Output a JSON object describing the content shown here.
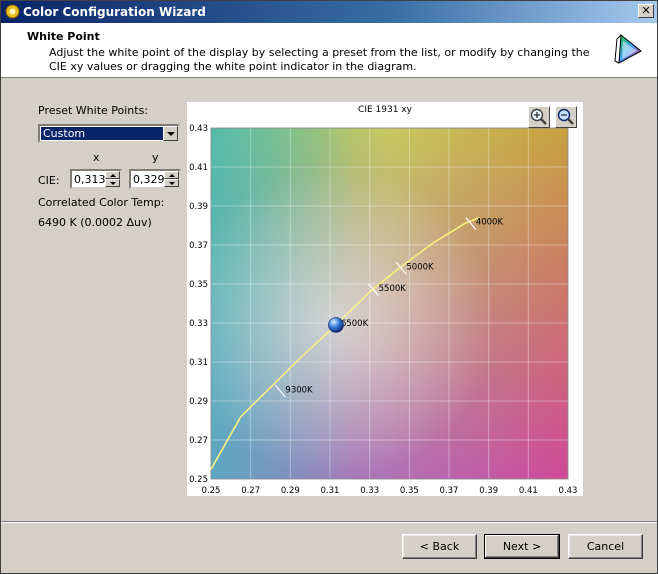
{
  "window": {
    "title": "Color Configuration Wizard"
  },
  "header": {
    "title": "White Point",
    "description": "Adjust the white point of the display by selecting a preset from the list, or modify by changing the CIE xy values or dragging the white point indicator in the diagram."
  },
  "preset": {
    "label": "Preset White Points:",
    "selected": "Custom"
  },
  "cie": {
    "label": "CIE:",
    "x_header": "x",
    "y_header": "y",
    "x_value": "0,313",
    "y_value": "0,329"
  },
  "cct": {
    "label": "Correlated Color Temp:",
    "value": "6490 K (0.0002 Δuv)"
  },
  "zoom_icons": [
    "zoom-in-icon",
    "zoom-out-icon"
  ],
  "chart_data": {
    "type": "scatter",
    "title": "CIE 1931 xy",
    "xlim": [
      0.25,
      0.43
    ],
    "ylim": [
      0.25,
      0.43
    ],
    "x_ticks": [
      "0.25",
      "0.27",
      "0.29",
      "0.31",
      "0.33",
      "0.35",
      "0.37",
      "0.39",
      "0.41",
      "0.43"
    ],
    "y_ticks": [
      "0.25",
      "0.27",
      "0.29",
      "0.31",
      "0.33",
      "0.35",
      "0.37",
      "0.39",
      "0.41",
      "0.43"
    ],
    "locus": {
      "x": [
        0.25,
        0.265,
        0.28,
        0.295,
        0.313,
        0.33,
        0.346,
        0.362,
        0.378,
        0.385
      ],
      "y": [
        0.255,
        0.282,
        0.297,
        0.312,
        0.329,
        0.346,
        0.359,
        0.371,
        0.381,
        0.384
      ]
    },
    "markers": [
      {
        "label": "9300K",
        "x": 0.285,
        "y": 0.295
      },
      {
        "label": "6500K",
        "x": 0.313,
        "y": 0.329
      },
      {
        "label": "5500K",
        "x": 0.332,
        "y": 0.347
      },
      {
        "label": "5000K",
        "x": 0.346,
        "y": 0.358
      },
      {
        "label": "4000K",
        "x": 0.381,
        "y": 0.381
      }
    ],
    "white_point": {
      "x": 0.313,
      "y": 0.329
    },
    "grid": true
  },
  "buttons": {
    "back": "< Back",
    "next": "Next >",
    "cancel": "Cancel"
  }
}
